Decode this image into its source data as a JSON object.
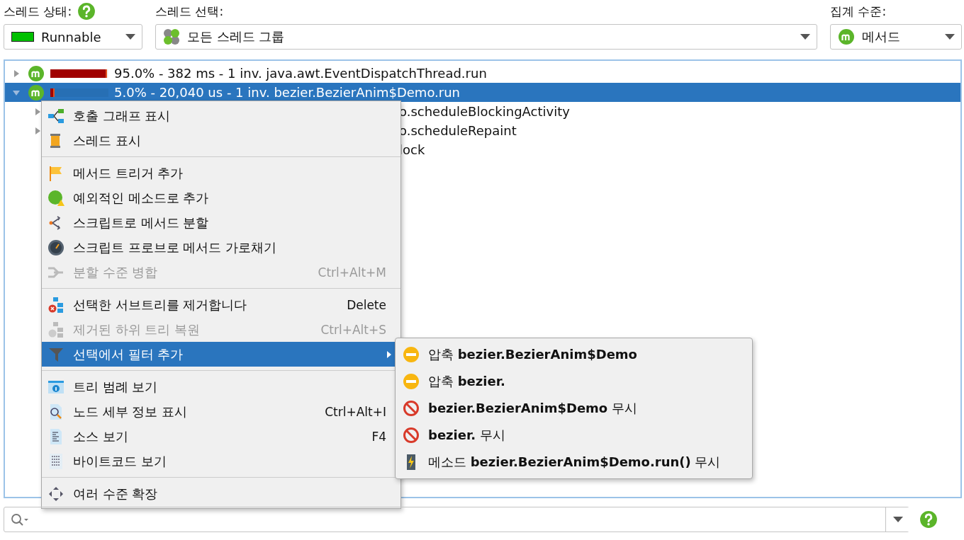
{
  "thread_state": {
    "label": "스레드 상태:",
    "value": "Runnable",
    "color": "#00c000"
  },
  "thread_selection": {
    "label": "스레드 선택:",
    "value": "모든 스레드 그룹"
  },
  "aggregation": {
    "label": "집계 수준:",
    "value": "메서드"
  },
  "tree": [
    {
      "text": "95.0% - 382 ms - 1 inv. java.awt.EventDispatchThread.run",
      "level": 0.95,
      "expanded": false,
      "selected": false
    },
    {
      "text": "5.0% - 20,040 us - 1 inv. bezier.BezierAnim$Demo.run",
      "level": 0.05,
      "expanded": true,
      "selected": true,
      "children": [
        {
          "text": "o.scheduleBlockingActivity",
          "expanded": false
        },
        {
          "text": "o.scheduleRepaint",
          "expanded": false
        },
        {
          "text": "lock"
        }
      ]
    }
  ],
  "context_menu": {
    "groups": [
      [
        {
          "label": "호출 그래프 표시",
          "disabled": false,
          "selected": false
        },
        {
          "label": "스레드 표시",
          "disabled": false,
          "selected": false
        }
      ],
      [
        {
          "label": "메서드 트리거 추가",
          "disabled": false,
          "selected": false
        },
        {
          "label": "예외적인 메소드로 추가",
          "disabled": false,
          "selected": false
        },
        {
          "label": "스크립트로 메서드 분할",
          "disabled": false,
          "selected": false
        },
        {
          "label": "스크립트 프로브로 메서드 가로채기",
          "disabled": false,
          "selected": false
        },
        {
          "label": "분할 수준 병합",
          "shortcut": "Ctrl+Alt+M",
          "disabled": true,
          "selected": false
        }
      ],
      [
        {
          "label": "선택한 서브트리를 제거합니다",
          "shortcut": "Delete",
          "disabled": false,
          "selected": false
        },
        {
          "label": "제거된 하위 트리 복원",
          "shortcut": "Ctrl+Alt+S",
          "disabled": true,
          "selected": false
        },
        {
          "label": "선택에서 필터 추가",
          "disabled": false,
          "selected": true,
          "submenu": true
        }
      ],
      [
        {
          "label": "트리 범례 보기",
          "disabled": false,
          "selected": false
        },
        {
          "label": "노드 세부 정보 표시",
          "shortcut": "Ctrl+Alt+I",
          "disabled": false,
          "selected": false
        },
        {
          "label": "소스 보기",
          "shortcut": "F4",
          "disabled": false,
          "selected": false
        },
        {
          "label": "바이트코드 보기",
          "disabled": false,
          "selected": false
        }
      ],
      [
        {
          "label": "여러 수준 확장",
          "disabled": false,
          "selected": false
        }
      ]
    ]
  },
  "submenu": [
    {
      "kind": "compress",
      "text": "압축 **bezier.BezierAnim$Demo**"
    },
    {
      "kind": "compress",
      "text": "압축 **bezier.**"
    },
    {
      "kind": "ignore",
      "text": "**bezier.BezierAnim$Demo** 무시"
    },
    {
      "kind": "ignore",
      "text": "**bezier.** 무시"
    },
    {
      "kind": "method",
      "text": "메소드 **bezier.BezierAnim$Demo.run()** 무시"
    }
  ]
}
